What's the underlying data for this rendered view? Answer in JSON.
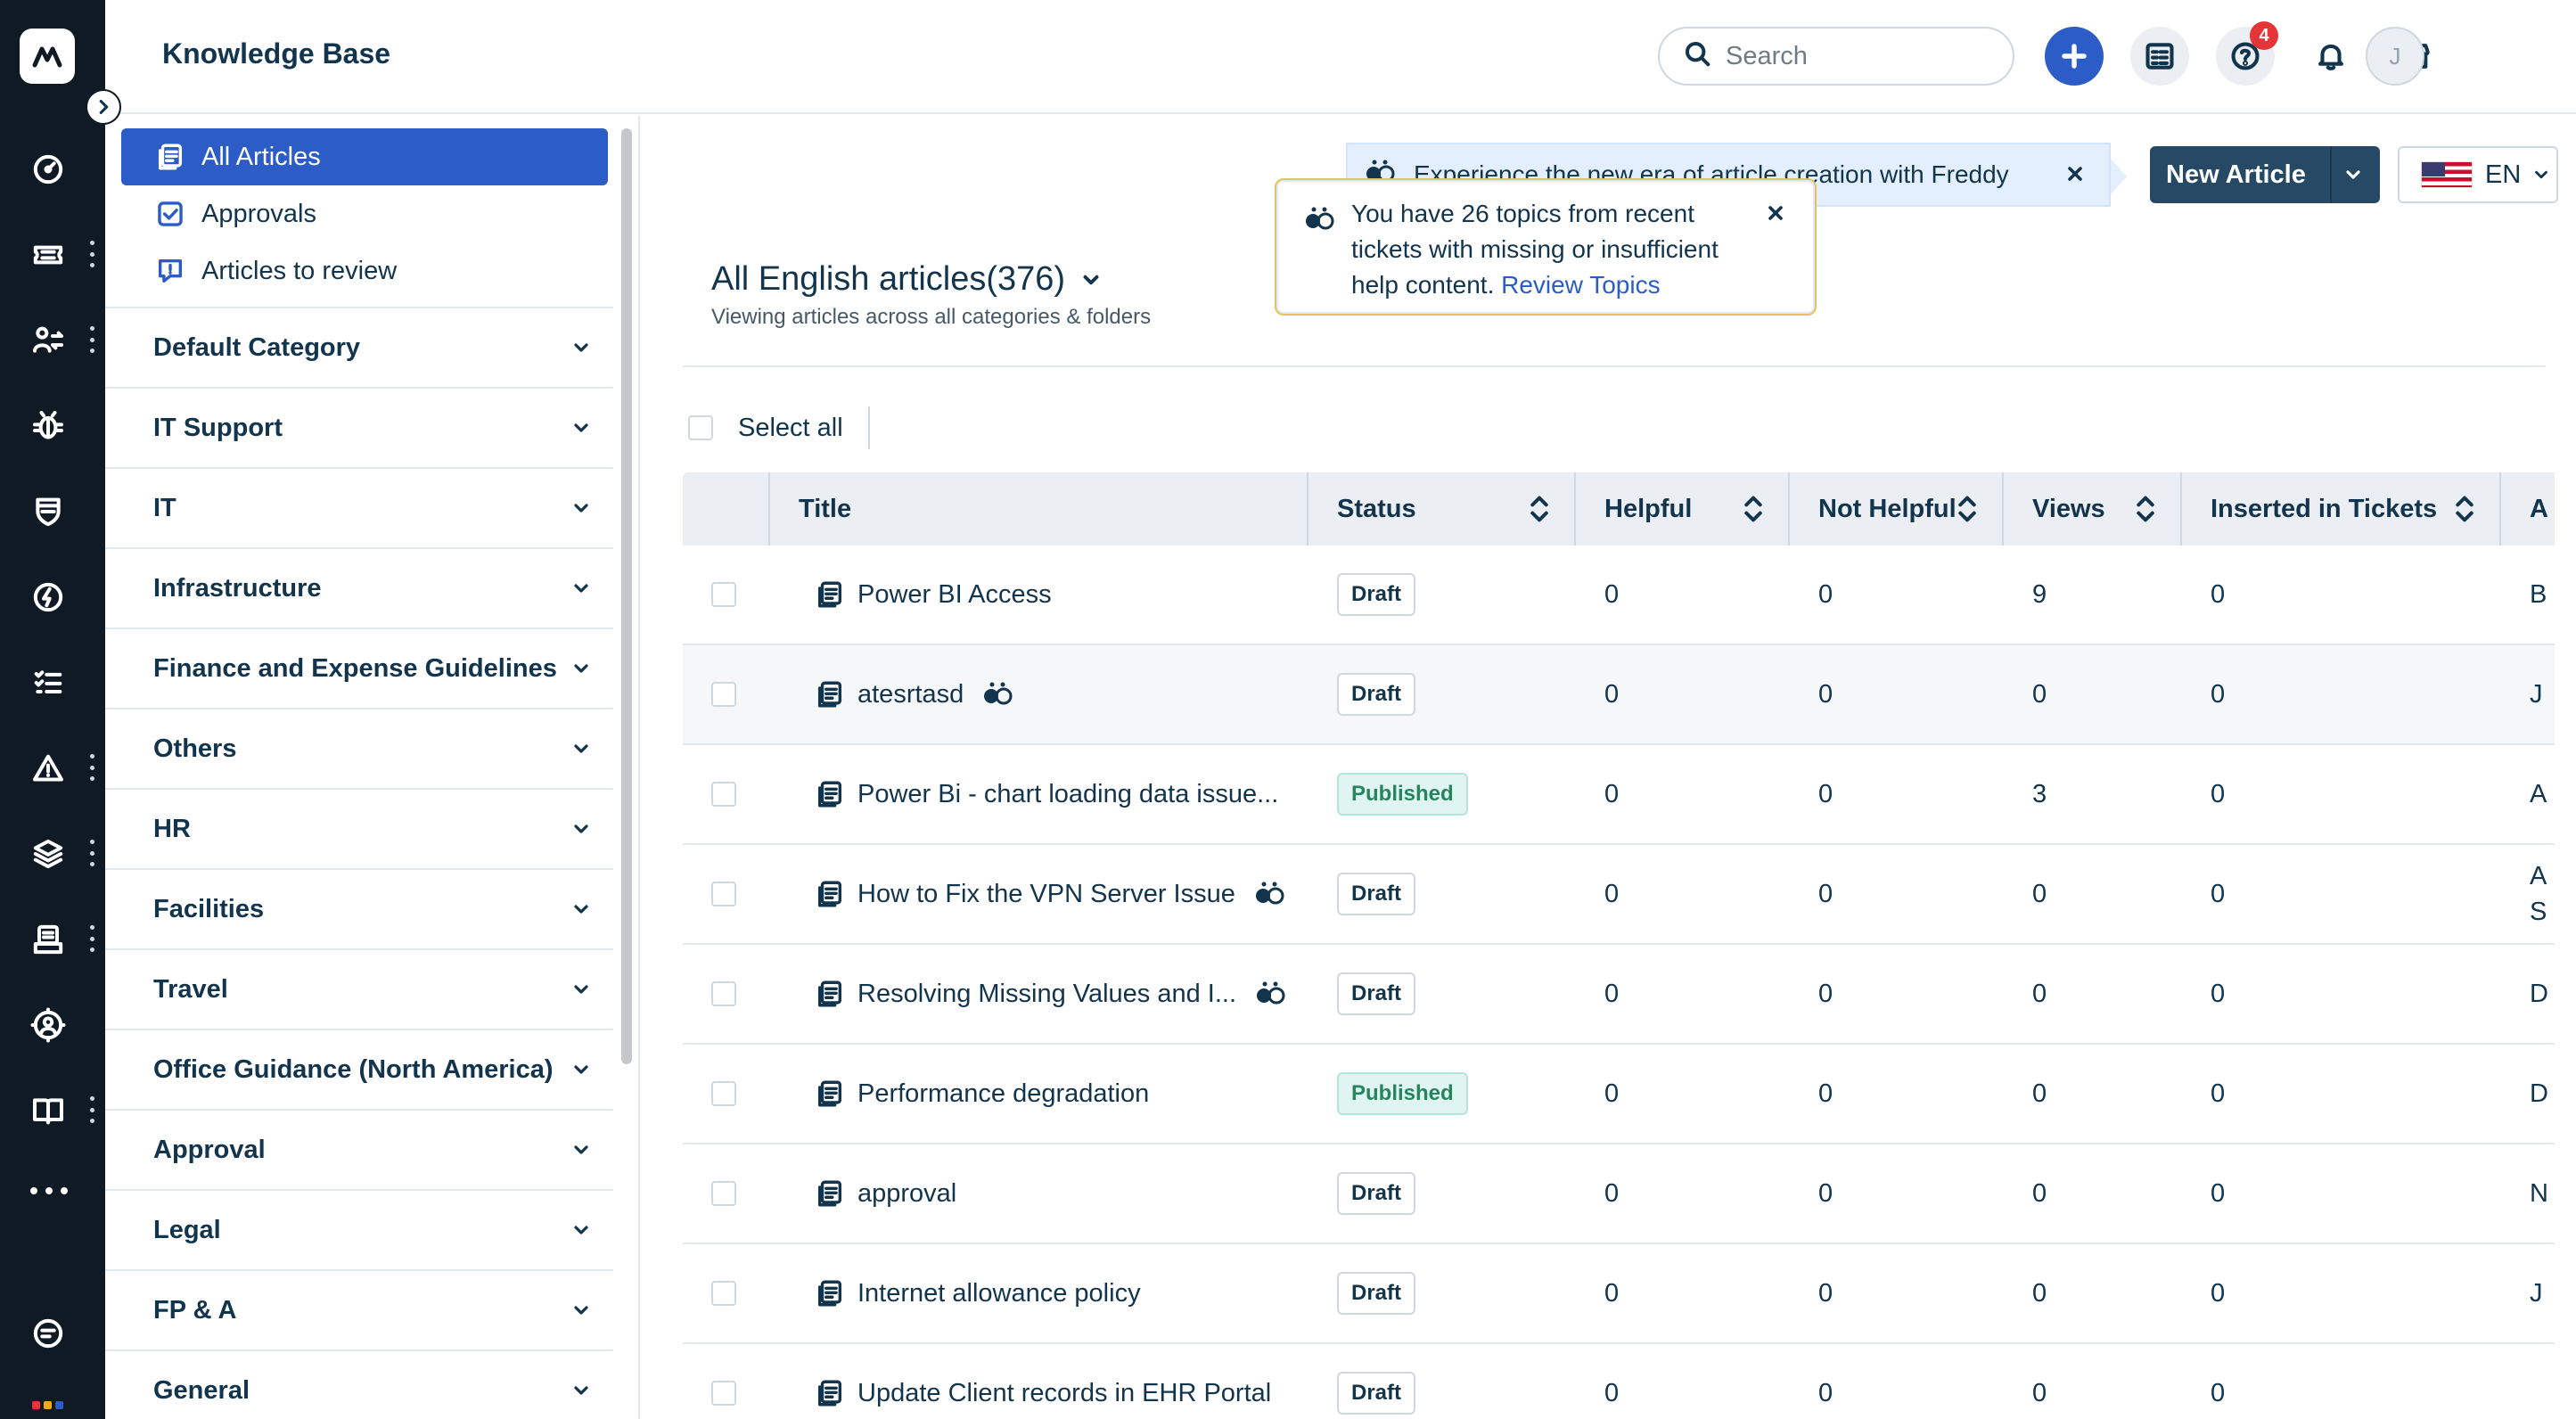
{
  "rail": {
    "items": [
      {
        "name": "dashboard-icon"
      },
      {
        "name": "tickets-icon"
      },
      {
        "name": "changes-icon"
      },
      {
        "name": "problems-icon"
      },
      {
        "name": "assets-icon"
      },
      {
        "name": "releases-icon"
      },
      {
        "name": "tasks-icon"
      },
      {
        "name": "alerts-icon"
      },
      {
        "name": "projects-icon"
      },
      {
        "name": "reports-icon"
      },
      {
        "name": "admin-icon"
      },
      {
        "name": "solutions-icon"
      },
      {
        "name": "chat-icon"
      }
    ]
  },
  "header": {
    "title": "Knowledge Base",
    "search_placeholder": "Search",
    "help_badge": "4",
    "avatar_initial": "J"
  },
  "sidebar": {
    "nav": [
      {
        "label": "All Articles",
        "active": true
      },
      {
        "label": "Approvals",
        "active": false
      },
      {
        "label": "Articles to review",
        "active": false
      }
    ],
    "categories": [
      "Default Category",
      "IT Support",
      "IT",
      "Infrastructure",
      "Finance and Expense Guidelines",
      "Others",
      "HR",
      "Facilities",
      "Travel",
      "Office Guidance (North America)",
      "Approval",
      "Legal",
      "FP & A",
      "General"
    ]
  },
  "main": {
    "freddy_banner": "Experience the new era of article creation with Freddy",
    "topics_popup": {
      "text": "You have 26 topics from recent tickets with missing or insufficient help content.",
      "link": "Review Topics"
    },
    "new_article_label": "New Article",
    "language": "EN",
    "list_title": "All English articles(376)",
    "list_subtitle": "Viewing articles across all categories & folders",
    "select_all": "Select all"
  },
  "table": {
    "columns": [
      "Title",
      "Status",
      "Helpful",
      "Not Helpful",
      "Views",
      "Inserted in Tickets",
      "A"
    ],
    "rows": [
      {
        "title": "Power BI Access",
        "freddy": false,
        "status": "Draft",
        "helpful": "0",
        "not_helpful": "0",
        "views": "9",
        "inserted": "0",
        "author": "B"
      },
      {
        "title": "atesrtasd",
        "freddy": true,
        "status": "Draft",
        "helpful": "0",
        "not_helpful": "0",
        "views": "0",
        "inserted": "0",
        "author": "J"
      },
      {
        "title": "Power Bi - chart loading data issue...",
        "freddy": false,
        "status": "Published",
        "helpful": "0",
        "not_helpful": "0",
        "views": "3",
        "inserted": "0",
        "author": "A"
      },
      {
        "title": "How to Fix the VPN Server Issue",
        "freddy": true,
        "status": "Draft",
        "helpful": "0",
        "not_helpful": "0",
        "views": "0",
        "inserted": "0",
        "author": "A\nS"
      },
      {
        "title": "Resolving Missing Values and I...",
        "freddy": true,
        "status": "Draft",
        "helpful": "0",
        "not_helpful": "0",
        "views": "0",
        "inserted": "0",
        "author": "D"
      },
      {
        "title": "Performance degradation",
        "freddy": false,
        "status": "Published",
        "helpful": "0",
        "not_helpful": "0",
        "views": "0",
        "inserted": "0",
        "author": "D"
      },
      {
        "title": "approval",
        "freddy": false,
        "status": "Draft",
        "helpful": "0",
        "not_helpful": "0",
        "views": "0",
        "inserted": "0",
        "author": "N"
      },
      {
        "title": "Internet allowance policy",
        "freddy": false,
        "status": "Draft",
        "helpful": "0",
        "not_helpful": "0",
        "views": "0",
        "inserted": "0",
        "author": "J"
      },
      {
        "title": "Update Client records in EHR Portal",
        "freddy": false,
        "status": "Draft",
        "helpful": "0",
        "not_helpful": "0",
        "views": "0",
        "inserted": "0",
        "author": ""
      }
    ]
  },
  "colors": {
    "rail_bg": "#0f1a24",
    "accent": "#2c5cc5",
    "primary_button": "#264966",
    "published": "#24855e",
    "badge": "#e43538"
  }
}
